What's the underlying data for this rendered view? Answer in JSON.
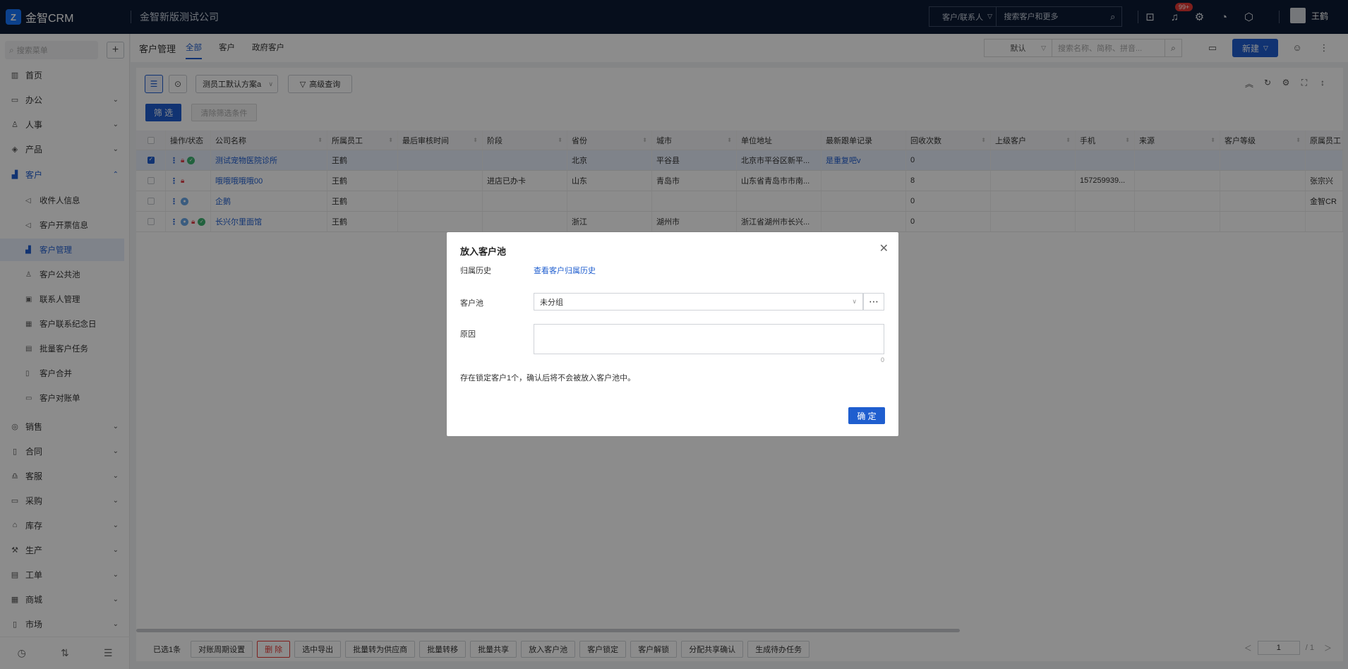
{
  "app": {
    "logo_mark": "Z",
    "name": "金智CRM",
    "company": "金智新版测试公司"
  },
  "top_search": {
    "type": "客户/联系人",
    "placeholder": "搜索客户和更多"
  },
  "notifications": {
    "badge": "99+"
  },
  "user": {
    "name": "王鹤"
  },
  "sidebar": {
    "search_placeholder": "搜索菜单",
    "items": [
      {
        "label": "首页",
        "icon": "home-icon"
      },
      {
        "label": "办公",
        "icon": "office-icon"
      },
      {
        "label": "人事",
        "icon": "hr-icon"
      },
      {
        "label": "产品",
        "icon": "product-icon"
      },
      {
        "label": "客户",
        "icon": "customer-icon"
      },
      {
        "label": "销售",
        "icon": "sales-icon"
      },
      {
        "label": "合同",
        "icon": "contract-icon"
      },
      {
        "label": "客服",
        "icon": "service-icon"
      },
      {
        "label": "采购",
        "icon": "purchase-icon"
      },
      {
        "label": "库存",
        "icon": "inventory-icon"
      },
      {
        "label": "生产",
        "icon": "production-icon"
      },
      {
        "label": "工单",
        "icon": "ticket-icon"
      },
      {
        "label": "商城",
        "icon": "mall-icon"
      },
      {
        "label": "市场",
        "icon": "market-icon"
      }
    ],
    "sub_items": [
      {
        "label": "收件人信息"
      },
      {
        "label": "客户开票信息"
      },
      {
        "label": "客户管理"
      },
      {
        "label": "客户公共池"
      },
      {
        "label": "联系人管理"
      },
      {
        "label": "客户联系纪念日"
      },
      {
        "label": "批量客户任务"
      },
      {
        "label": "客户合并"
      },
      {
        "label": "客户对账单"
      }
    ]
  },
  "header": {
    "title": "客户管理",
    "tabs": [
      {
        "label": "全部"
      },
      {
        "label": "客户"
      },
      {
        "label": "政府客户"
      }
    ],
    "view": "默认",
    "search_placeholder": "搜索名称、简称、拼音...",
    "new_label": "新建"
  },
  "toolbar": {
    "scheme": "测员工默认方案a",
    "advanced": "高级查询",
    "filter": "筛 选",
    "clear": "清除筛选条件"
  },
  "table": {
    "columns": [
      "操作/状态",
      "公司名称",
      "所属员工",
      "最后审核时间",
      "阶段",
      "省份",
      "城市",
      "单位地址",
      "最新跟单记录",
      "回收次数",
      "上级客户",
      "手机",
      "来源",
      "客户等级",
      "原属员工"
    ],
    "rows": [
      {
        "checked": true,
        "name": "测试宠物医院诊所",
        "employee": "王鹤",
        "review": "",
        "stage": "",
        "province": "北京",
        "city": "平谷县",
        "address": "北京市平谷区新平...",
        "followup": "是重复吧v",
        "recycle": "0",
        "parent": "",
        "phone": "",
        "source": "",
        "level": "",
        "orig": ""
      },
      {
        "checked": false,
        "name": "哦哦哦哦哦00",
        "employee": "王鹤",
        "review": "",
        "stage": "进店已办卡",
        "province": "山东",
        "city": "青岛市",
        "address": "山东省青岛市市南...",
        "followup": "",
        "recycle": "8",
        "parent": "",
        "phone": "157259939...",
        "source": "",
        "level": "",
        "orig": "张宗兴"
      },
      {
        "checked": false,
        "name": "企鹅",
        "employee": "王鹤",
        "review": "",
        "stage": "",
        "province": "",
        "city": "",
        "address": "",
        "followup": "",
        "recycle": "0",
        "parent": "",
        "phone": "",
        "source": "",
        "level": "",
        "orig": "金智CR"
      },
      {
        "checked": false,
        "name": "长兴尔里面馆",
        "employee": "王鹤",
        "review": "",
        "stage": "",
        "province": "浙江",
        "city": "湖州市",
        "address": "浙江省湖州市长兴...",
        "followup": "",
        "recycle": "0",
        "parent": "",
        "phone": "",
        "source": "",
        "level": "",
        "orig": ""
      }
    ]
  },
  "bottom_bar": {
    "selected": "已选1条",
    "actions": [
      "对账周期设置",
      "删 除",
      "选中导出",
      "批量转为供应商",
      "批量转移",
      "批量共享",
      "放入客户池",
      "客户锁定",
      "客户解锁",
      "分配共享确认",
      "生成待办任务"
    ],
    "page": "1",
    "total": "/ 1"
  },
  "modal": {
    "title": "放入客户池",
    "history_label": "归属历史",
    "history_link": "查看客户归属历史",
    "pool_label": "客户池",
    "pool_value": "未分组",
    "reason_label": "原因",
    "reason_count": "0",
    "note": "存在锁定客户1个，确认后将不会被放入客户池中。",
    "confirm": "确 定"
  }
}
